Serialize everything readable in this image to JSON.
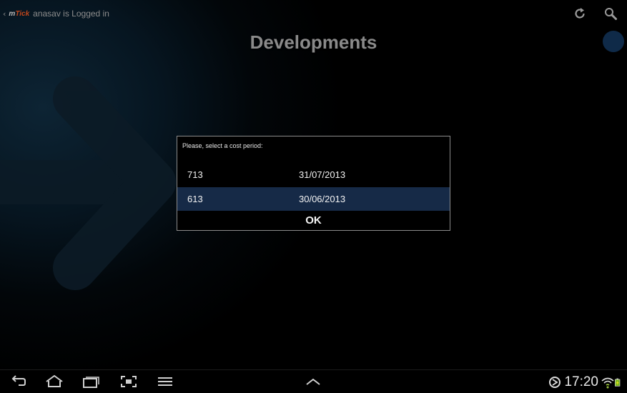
{
  "app": {
    "logo_m": "m",
    "logo_tick": "Tick",
    "logged_in_text": "anasav is Logged in",
    "page_title": "Developments"
  },
  "colors": {
    "accent_orange": "#c0461c",
    "selected_row": "#162a47",
    "indicator": "#0f2a48"
  },
  "icons": {
    "refresh": "refresh-icon",
    "search": "search-icon",
    "back": "back-icon",
    "home": "home-icon",
    "recent": "recent-apps-icon",
    "screenshot": "screenshot-icon",
    "menu": "menu-icon",
    "expand": "chevron-up-icon",
    "sync_status": "sync-icon",
    "wifi_status": "wifi-icon",
    "battery_status": "battery-charging-icon"
  },
  "dialog": {
    "prompt": "Please, select a cost period:",
    "periods": [
      {
        "number": "713",
        "date": "31/07/2013",
        "selected": false
      },
      {
        "number": "613",
        "date": "30/06/2013",
        "selected": true
      }
    ],
    "ok_label": "OK"
  },
  "status_bar": {
    "time": "17:20"
  }
}
